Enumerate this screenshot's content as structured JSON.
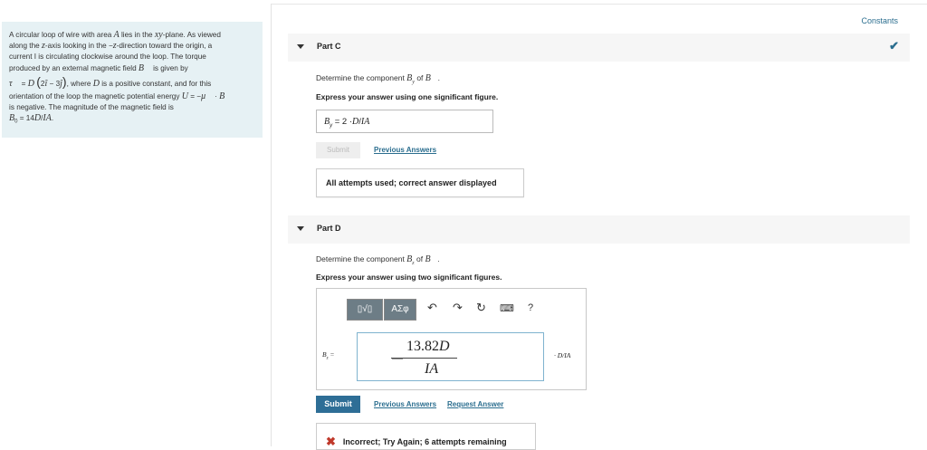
{
  "header": {
    "constants_link": "Constants"
  },
  "problem": {
    "lines": [
      "A circular loop of wire with area A lies in the xy-plane. As viewed",
      "along the z-axis looking in the −z-direction toward the origin, a",
      "current I is circulating clockwise around the loop. The torque",
      "produced by an external magnetic field B is given by",
      "τ = D (2î − 3ĵ), where D is a positive constant, and for this",
      "orientation of the loop the magnetic potential energy U = −μ·B",
      "is negative. The magnitude of the magnetic field is",
      "B₀ = 14D/IA."
    ]
  },
  "partC": {
    "title": "Part C",
    "prompt": "Determine the component B_y of B.",
    "instruction": "Express your answer using one significant figure.",
    "answer": "B_y = 2 ·D/IA",
    "submit_label": "Submit",
    "previous_answers_label": "Previous Answers",
    "status": "All attempts used; correct answer displayed"
  },
  "partD": {
    "title": "Part D",
    "prompt": "Determine the component B_z of B.",
    "instruction": "Express your answer using two significant figures.",
    "toolbar": {
      "templates": "▯√▯",
      "greek": "ΑΣφ",
      "help": "?"
    },
    "variable_label": "B_z =",
    "numerator": "13.82D",
    "denominator": "IA",
    "unit_label": "· D/IA",
    "submit_label": "Submit",
    "previous_answers_label": "Previous Answers",
    "request_answer_label": "Request Answer",
    "status": "Incorrect; Try Again; 6 attempts remaining"
  }
}
